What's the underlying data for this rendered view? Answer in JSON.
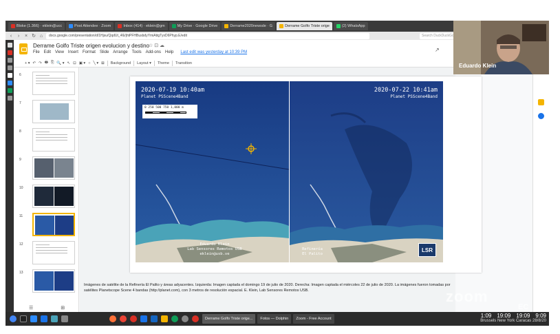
{
  "browser": {
    "tabs": [
      {
        "label": "Bloke (1.366) · eklein@ucc",
        "color": "#d93025"
      },
      {
        "label": "Post Attendee · Zoom",
        "color": "#2d8cff"
      },
      {
        "label": "Inbox (414) · eklein@gm",
        "color": "#d93025"
      },
      {
        "label": "My Drive · Google Drive",
        "color": "#0f9d58"
      },
      {
        "label": "Derrame2020newsde · G",
        "color": "#f4b400"
      },
      {
        "label": "Derrame Golfo Triste orige",
        "color": "#f4b400",
        "active": true
      },
      {
        "label": "(2) WhatsApp",
        "color": "#25d366"
      }
    ],
    "url": "docs.google.com/presentation/d/1Hjsu/QqdUt_46i/jhtPFHBusbdyYmiAttgTyxD6Phyp.E/edit",
    "search_placeholder": "Search DuckDuckGo"
  },
  "doc": {
    "title": "Derrame Golfo Triste origen evolucion y destino",
    "title_icons": "☆ ⊡ ☁",
    "menus": [
      "File",
      "Edit",
      "View",
      "Insert",
      "Format",
      "Slide",
      "Arrange",
      "Tools",
      "Add-ons",
      "Help"
    ],
    "last_edit": "Last edit was yesterday at 10:39 PM"
  },
  "toolbar": {
    "items": [
      "+ ▾",
      "↶",
      "↷",
      "🖶",
      "⎘",
      "🔍 ▾",
      "↖",
      "⊡",
      "▣ ▾",
      "○",
      "╲ ▾",
      "⊞"
    ],
    "background": "Background",
    "layout": "Layout ▾",
    "theme": "Theme",
    "transition": "Transition"
  },
  "filmstrip": {
    "slides": [
      {
        "num": "6",
        "kind": "text"
      },
      {
        "num": "7",
        "kind": "map"
      },
      {
        "num": "8",
        "kind": "text"
      },
      {
        "num": "9",
        "kind": "photo"
      },
      {
        "num": "10",
        "kind": "photo-dark"
      },
      {
        "num": "11",
        "kind": "sat",
        "selected": true
      },
      {
        "num": "12",
        "kind": "text"
      },
      {
        "num": "13",
        "kind": "sat"
      }
    ],
    "bottom_left": "☰",
    "bottom_right": "⊞"
  },
  "slide": {
    "left": {
      "date": "2020-07-19 10:40am",
      "sub": "Planet PSScene4Band",
      "scale_text": "0  250  500  750 1,000 m",
      "credit": [
        "Eduardo Klein",
        "Lab Sensores Remotos USB",
        "eklein@usb.ve"
      ]
    },
    "right": {
      "date": "2020-07-22 10:41am",
      "sub": "Planet PSScene4Band",
      "credit": [
        "Refinería",
        "El Palito"
      ],
      "logo": "LSR"
    },
    "caption": "Imágenes de satélite de la Refinería El Palito y áreas adyacentes. Izquierda: Imagen captada el domingo 19 de julio de 2020. Derecha: Imagen captada el miércoles 22 de julio de 2020. La imágenes fueron tomadas por satélites Planetscope Scene 4 bandas (http://planet.com), con 3 metros de resolución espacial. E. Klein, Lab Sensores Remotos USB."
  },
  "webcam": {
    "name": "Eduardo Klein"
  },
  "watermark": {
    "main": "zoom",
    "sub": "EC"
  },
  "taskbar": {
    "tasks": [
      {
        "label": "Derrame Golfo Triste orige...",
        "active": true
      },
      {
        "label": "Fotos — Dolphin"
      },
      {
        "label": "Zoom - Free Account"
      }
    ],
    "clocks": [
      "1:09",
      "19:09",
      "19:09",
      "9:09"
    ],
    "cities": "Brussels New York Caracas 28/8/20",
    "locale": "us"
  }
}
